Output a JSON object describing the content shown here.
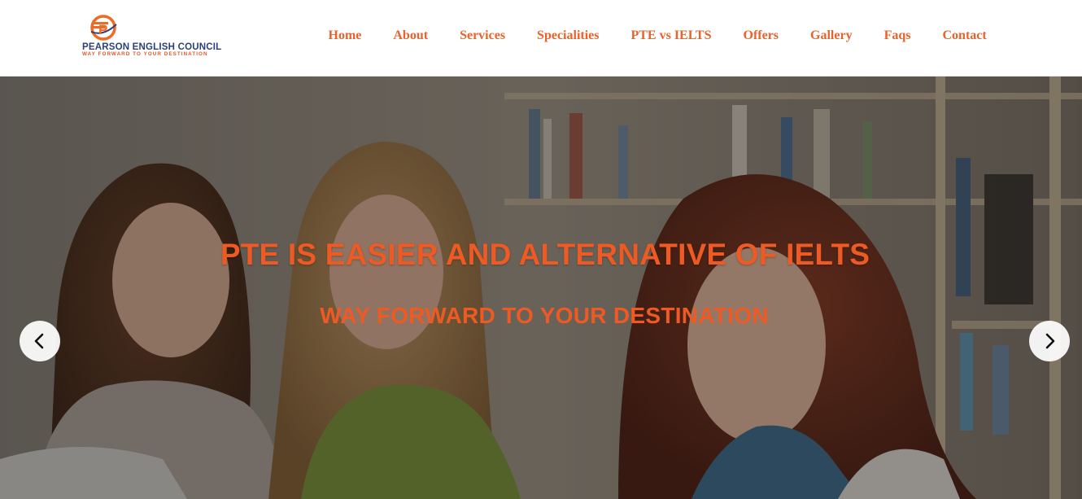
{
  "brand": {
    "name": "PEARSON ENGLISH COUNCIL",
    "tagline": "WAY FORWARD TO YOUR DESTINATION",
    "logo_icon": "pec-logo-icon"
  },
  "nav": {
    "items": [
      {
        "label": "Home"
      },
      {
        "label": "About"
      },
      {
        "label": "Services"
      },
      {
        "label": "Specialities"
      },
      {
        "label": "PTE vs IELTS"
      },
      {
        "label": "Offers"
      },
      {
        "label": "Gallery"
      },
      {
        "label": "Faqs"
      },
      {
        "label": "Contact"
      }
    ]
  },
  "hero": {
    "title": "PTE IS EASIER AND ALTERNATIVE OF IELTS",
    "subtitle": "WAY FORWARD TO YOUR DESTINATION",
    "prev_icon": "chevron-left-icon",
    "next_icon": "chevron-right-icon"
  },
  "colors": {
    "accent": "#ee5a23",
    "brand_blue": "#2b3f7a"
  }
}
